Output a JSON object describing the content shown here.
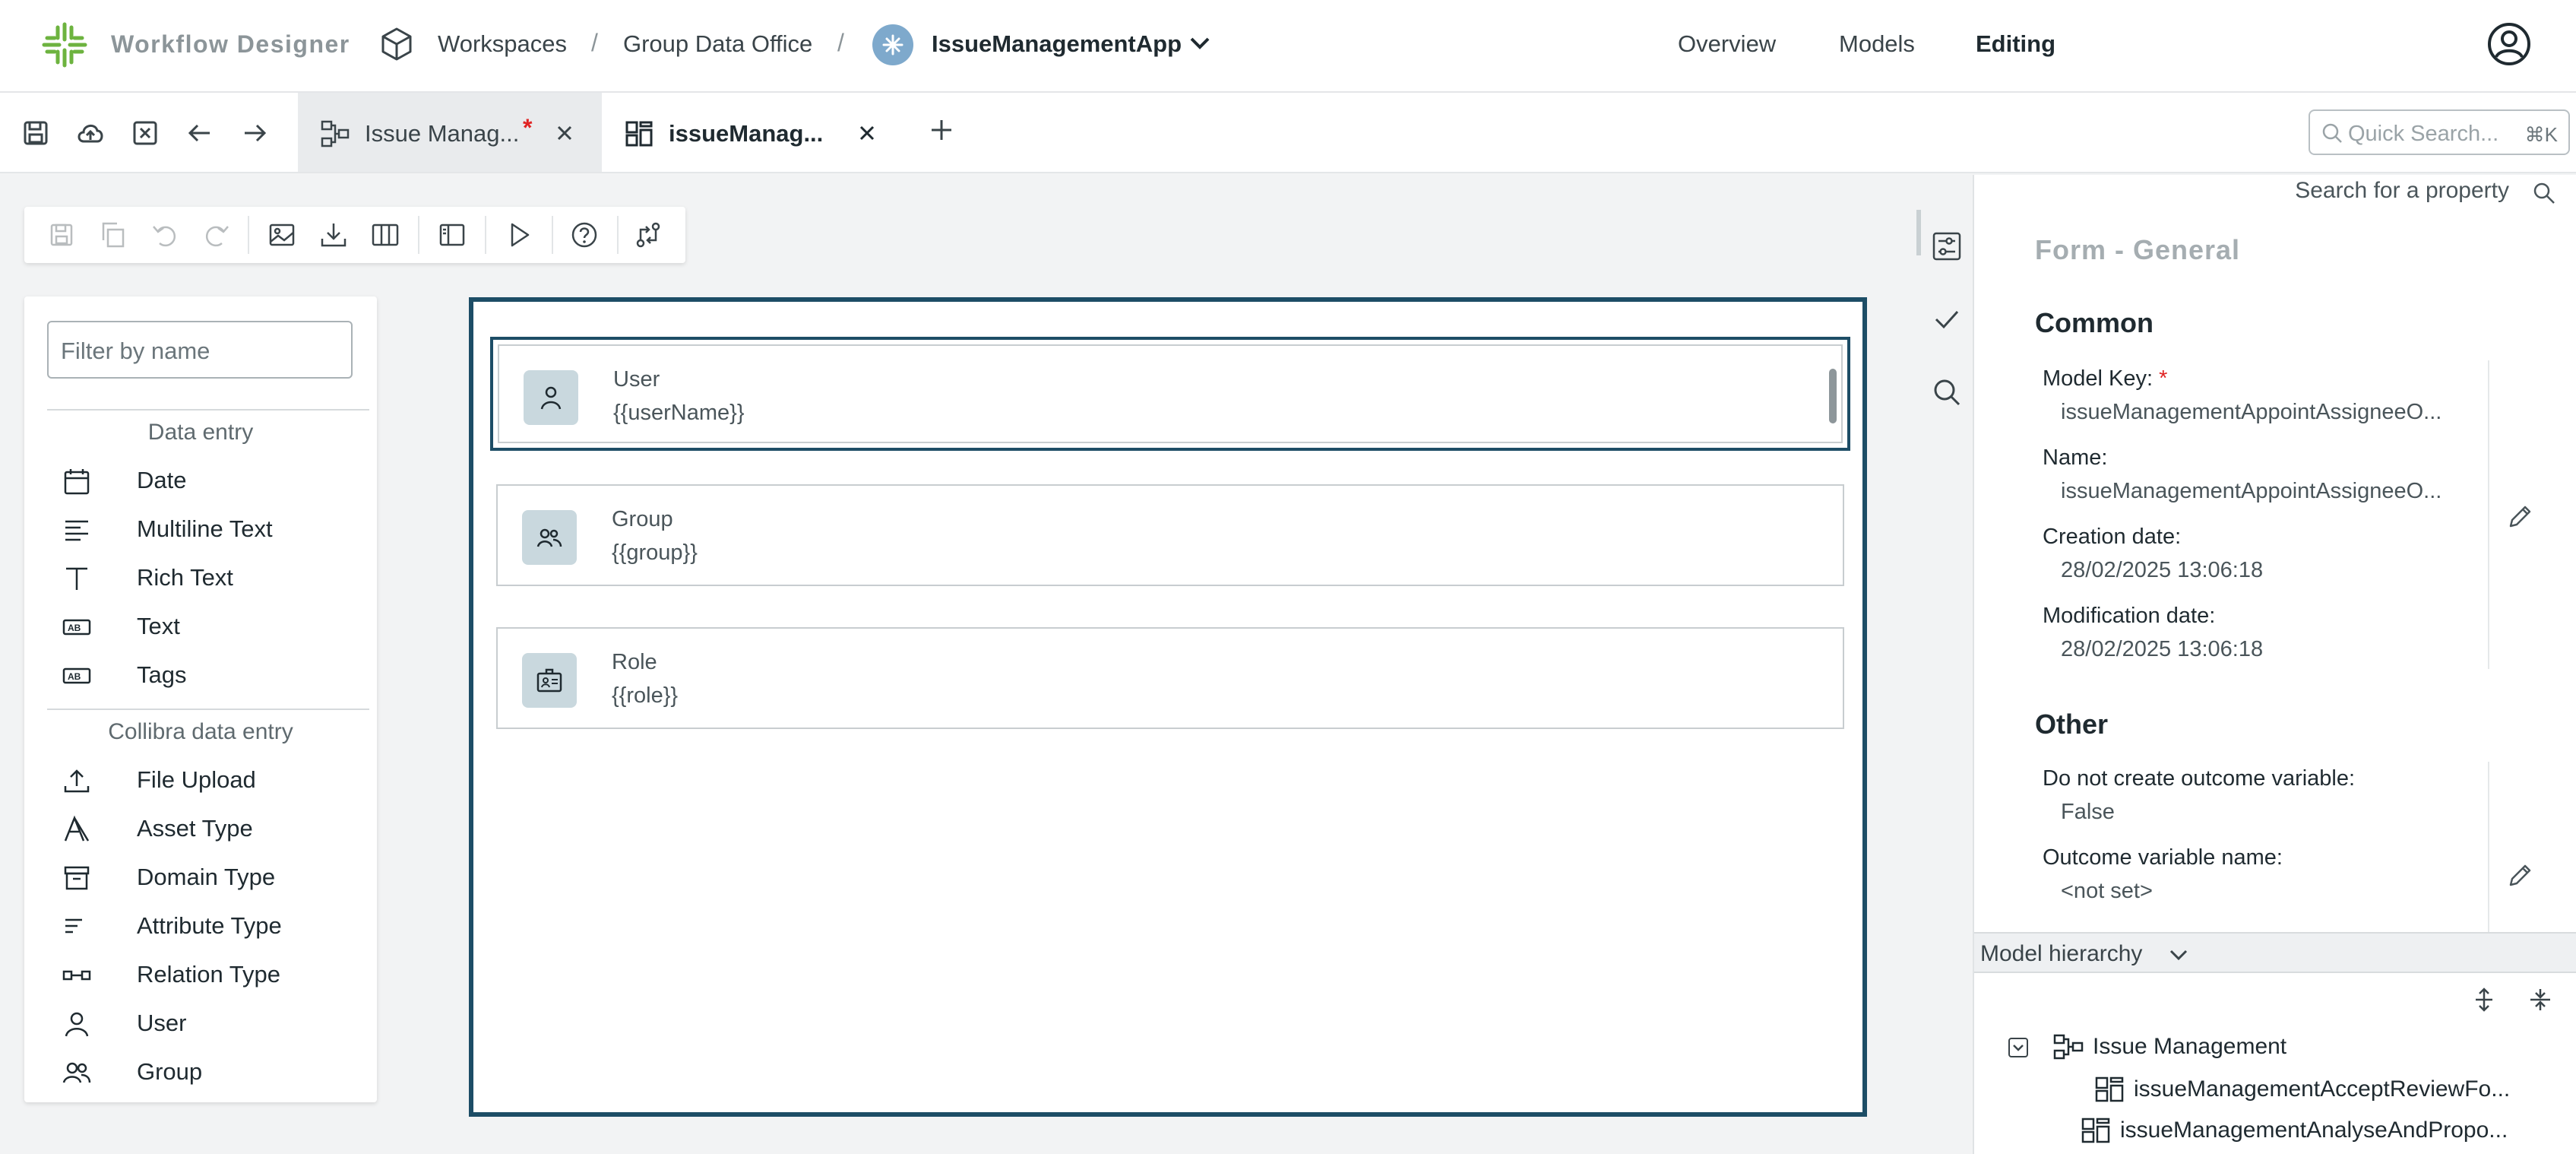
{
  "header": {
    "app_title": "Workflow Designer",
    "breadcrumb": [
      "Workspaces",
      "Group Data Office"
    ],
    "app_name": "IssueManagementApp",
    "nav": [
      "Overview",
      "Models",
      "Editing"
    ],
    "active_nav": "Editing"
  },
  "tabs": [
    {
      "label": "Issue Manag...",
      "dirty_marker": "*"
    },
    {
      "label": "issueManag..."
    }
  ],
  "quick_search": {
    "placeholder": "Quick Search...",
    "shortcut": "⌘K"
  },
  "palette": {
    "filter_placeholder": "Filter by name",
    "sections": [
      {
        "title": "Data entry",
        "items": [
          "Date",
          "Multiline Text",
          "Rich Text",
          "Text",
          "Tags"
        ]
      },
      {
        "title": "Collibra data entry",
        "items": [
          "File Upload",
          "Asset Type",
          "Domain Type",
          "Attribute Type",
          "Relation Type",
          "User",
          "Group"
        ]
      }
    ]
  },
  "canvas": {
    "fields": [
      {
        "label": "User",
        "value": "{{userName}}",
        "icon": "user-icon"
      },
      {
        "label": "Group",
        "value": "{{group}}",
        "icon": "group-icon"
      },
      {
        "label": "Role",
        "value": "{{role}}",
        "icon": "role-icon"
      }
    ]
  },
  "properties": {
    "search_label": "Search for a property",
    "section_title": "Form - General",
    "common": {
      "title": "Common",
      "model_key_label": "Model Key:",
      "required_marker": "*",
      "model_key_value": "issueManagementAppointAssigneeO...",
      "name_label": "Name:",
      "name_value": "issueManagementAppointAssigneeO...",
      "creation_label": "Creation date:",
      "creation_value": "28/02/2025 13:06:18",
      "modification_label": "Modification date:",
      "modification_value": "28/02/2025 13:06:18"
    },
    "other": {
      "title": "Other",
      "no_outcome_label": "Do not create outcome variable:",
      "no_outcome_value": "False",
      "outcome_name_label": "Outcome variable name:",
      "outcome_name_value": "<not set>"
    }
  },
  "hierarchy": {
    "title": "Model hierarchy",
    "root": "Issue Management",
    "children": [
      "issueManagementAcceptReviewFo...",
      "issueManagementAnalyseAndPropo..."
    ]
  },
  "colors": {
    "brand": "#6db33f",
    "canvas_border": "#1d4d66",
    "required": "#e02424",
    "app_badge": "#7ea9cc"
  }
}
